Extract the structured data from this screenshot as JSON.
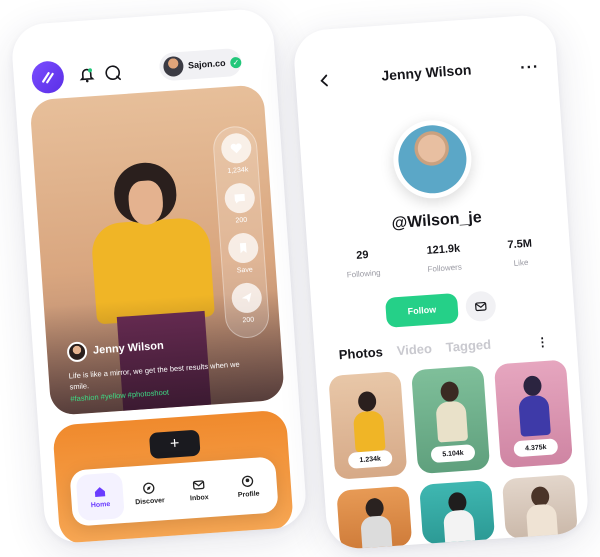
{
  "left_phone": {
    "header": {
      "user_chip_name": "Sajon.co",
      "icons": [
        "app-logo-icon",
        "bell-icon",
        "chat-icon",
        "verified-check-icon"
      ]
    },
    "post": {
      "author_name": "Jenny Wilson",
      "caption": "Life is like a mirror, we get the best results when we smile.",
      "tags": "#fashion #yellow #photoshoot",
      "actions": [
        {
          "icon": "heart-icon",
          "label": "1,234k"
        },
        {
          "icon": "comment-icon",
          "label": "200"
        },
        {
          "icon": "bookmark-icon",
          "label": "Save"
        },
        {
          "icon": "send-icon",
          "label": "200"
        }
      ]
    },
    "next_card": {
      "add_label": "+"
    },
    "bottom_nav": [
      {
        "icon": "home-icon",
        "label": "Home",
        "active": true
      },
      {
        "icon": "compass-icon",
        "label": "Discover",
        "active": false
      },
      {
        "icon": "inbox-icon",
        "label": "Inbox",
        "active": false
      },
      {
        "icon": "profile-icon",
        "label": "Profile",
        "active": false
      }
    ]
  },
  "right_phone": {
    "title": "Jenny Wilson",
    "more_label": "···",
    "handle": "@Wilson_je",
    "stats": [
      {
        "value": "29",
        "label": "Following"
      },
      {
        "value": "121.9k",
        "label": "Followers"
      },
      {
        "value": "7.5M",
        "label": "Like"
      }
    ],
    "follow_label": "Follow",
    "tabs": [
      {
        "label": "Photos",
        "active": true
      },
      {
        "label": "Video",
        "active": false
      },
      {
        "label": "Tagged",
        "active": false
      }
    ],
    "tab_more_label": "⋮",
    "photos": [
      {
        "count": "1.234k"
      },
      {
        "count": "5.104k"
      },
      {
        "count": "4.375k"
      },
      {
        "count": ""
      },
      {
        "count": ""
      },
      {
        "count": ""
      }
    ]
  },
  "colors": {
    "accent_purple": "#6a3cff",
    "follow_green": "#25d088",
    "hashtag_green": "#3ddc84"
  }
}
